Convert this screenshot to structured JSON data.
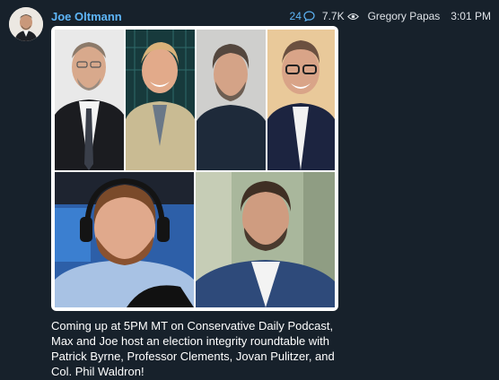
{
  "message": {
    "sender": "Joe Oltmann",
    "replies_count": "24",
    "views_count": "7.7K",
    "post_author": "Gregory Papas",
    "time": "3:01 PM",
    "text": "Coming up at 5PM MT on Conservative Daily Podcast, Max and Joe host an election integrity roundtable with Patrick Byrne, Professor Clements, Jovan Pulitzer, and Col. Phil Waldron!"
  },
  "icons": {
    "replies": "reply-bubble-icon",
    "views": "eye-icon"
  },
  "colors": {
    "background": "#17212b",
    "sender_name": "#5eb5f7",
    "text": "#ffffff"
  }
}
